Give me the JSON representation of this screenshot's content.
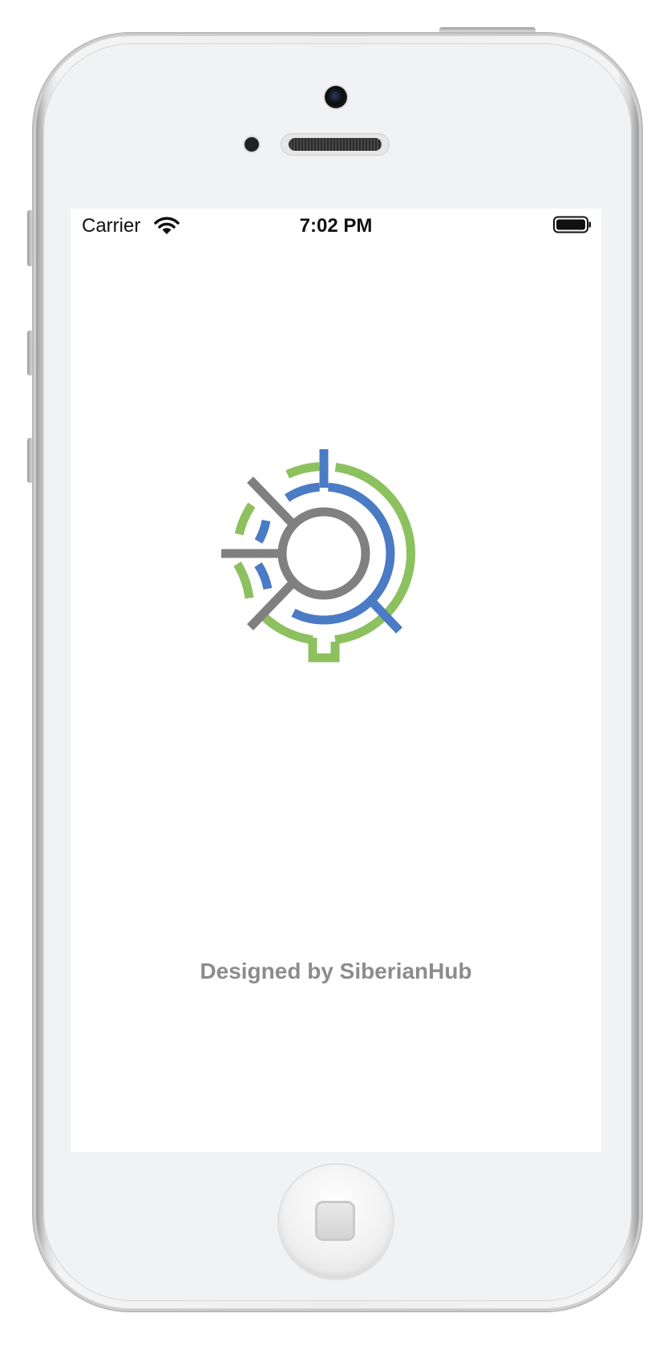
{
  "status_bar": {
    "carrier": "Carrier",
    "time": "7:02 PM",
    "wifi_icon": "wifi-icon",
    "battery_icon": "battery-full-icon"
  },
  "splash": {
    "logo_icon": "siberianhub-logo-icon",
    "credit": "Designed by SiberianHub"
  },
  "colors": {
    "logo_green": "#8dc05f",
    "logo_blue": "#4a7bc4",
    "logo_gray": "#808080",
    "credit_text": "#8c8c8c"
  }
}
